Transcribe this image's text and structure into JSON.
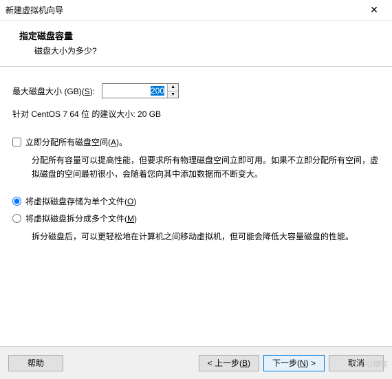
{
  "window": {
    "title": "新建虚拟机向导",
    "close_glyph": "✕"
  },
  "header": {
    "heading": "指定磁盘容量",
    "subheading": "磁盘大小为多少?"
  },
  "disk_size": {
    "label_pre": "最大磁盘大小 (GB)(",
    "label_key": "S",
    "label_post": "):",
    "value": "200",
    "spin_up": "▲",
    "spin_down": "▼"
  },
  "recommend": "针对 CentOS 7 64 位 的建议大小: 20 GB",
  "allocate": {
    "label_pre": "立即分配所有磁盘空间(",
    "label_key": "A",
    "label_post": ")。",
    "checked": false,
    "desc": "分配所有容量可以提高性能，但要求所有物理磁盘空间立即可用。如果不立即分配所有空间，虚拟磁盘的空间最初很小，会随着您向其中添加数据而不断变大。"
  },
  "radios": {
    "single": {
      "pre": "将虚拟磁盘存储为单个文件(",
      "key": "O",
      "post": ")",
      "checked": true
    },
    "split": {
      "pre": "将虚拟磁盘拆分成多个文件(",
      "key": "M",
      "post": ")",
      "checked": false
    },
    "split_desc": "拆分磁盘后，可以更轻松地在计算机之间移动虚拟机，但可能会降低大容量磁盘的性能。"
  },
  "buttons": {
    "help": "帮助",
    "back_pre": "< 上一步(",
    "back_key": "B",
    "back_post": ")",
    "next_pre": "下一步(",
    "next_key": "N",
    "next_post": ") >",
    "cancel": "取消"
  },
  "watermark": "51 TO博客"
}
